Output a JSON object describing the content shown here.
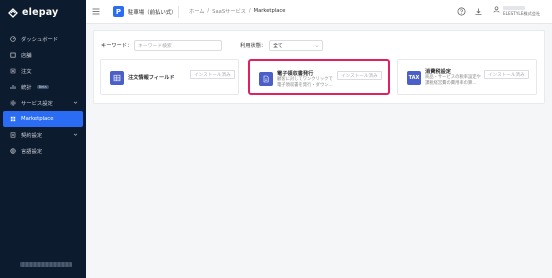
{
  "app": {
    "logo_text": "elepay",
    "logo_color": "#2a6df4",
    "accent": "#2a6df4",
    "highlight": "#e0215e"
  },
  "sidebar": {
    "items": [
      {
        "label": "ダッシュボード",
        "icon": "dashboard-icon"
      },
      {
        "label": "店舗",
        "icon": "store-icon"
      },
      {
        "label": "注文",
        "icon": "order-icon"
      },
      {
        "label": "統計",
        "icon": "stats-icon",
        "badge": "Beta"
      },
      {
        "label": "サービス設定",
        "icon": "gear-icon",
        "expandable": true
      },
      {
        "label": "Marketplace",
        "icon": "marketplace-icon",
        "active": true
      },
      {
        "label": "契約設定",
        "icon": "contract-icon",
        "expandable": true
      },
      {
        "label": "言語設定",
        "icon": "globe-icon"
      }
    ]
  },
  "header": {
    "app_icon_letter": "P",
    "store_name": "駐車場（前払い式）",
    "breadcrumb": [
      "ホーム",
      "/",
      "SaaSサービス",
      "/",
      "Marketplace"
    ],
    "user_company": "ELESTYLE株式会社"
  },
  "filters": {
    "keyword_label": "キーワード：",
    "keyword_placeholder": "キーワード検索",
    "status_label": "利用状態：",
    "status_value": "全て"
  },
  "cards": [
    {
      "title": "注文情報フィールド",
      "desc": [],
      "button": "インストール済み",
      "icon": "grid-icon"
    },
    {
      "title": "電子領収書発行",
      "desc": [
        "顧客に対してワンクリックで",
        "電子領収書を発行・ダウン..."
      ],
      "button": "インストール済み",
      "icon": "document-icon"
    },
    {
      "title": "消費税設定",
      "desc": [
        "商品・サービスの税率設定や",
        "課税経営費の費用率の算..."
      ],
      "button": "インストール済み",
      "icon_text": "TAX"
    }
  ]
}
